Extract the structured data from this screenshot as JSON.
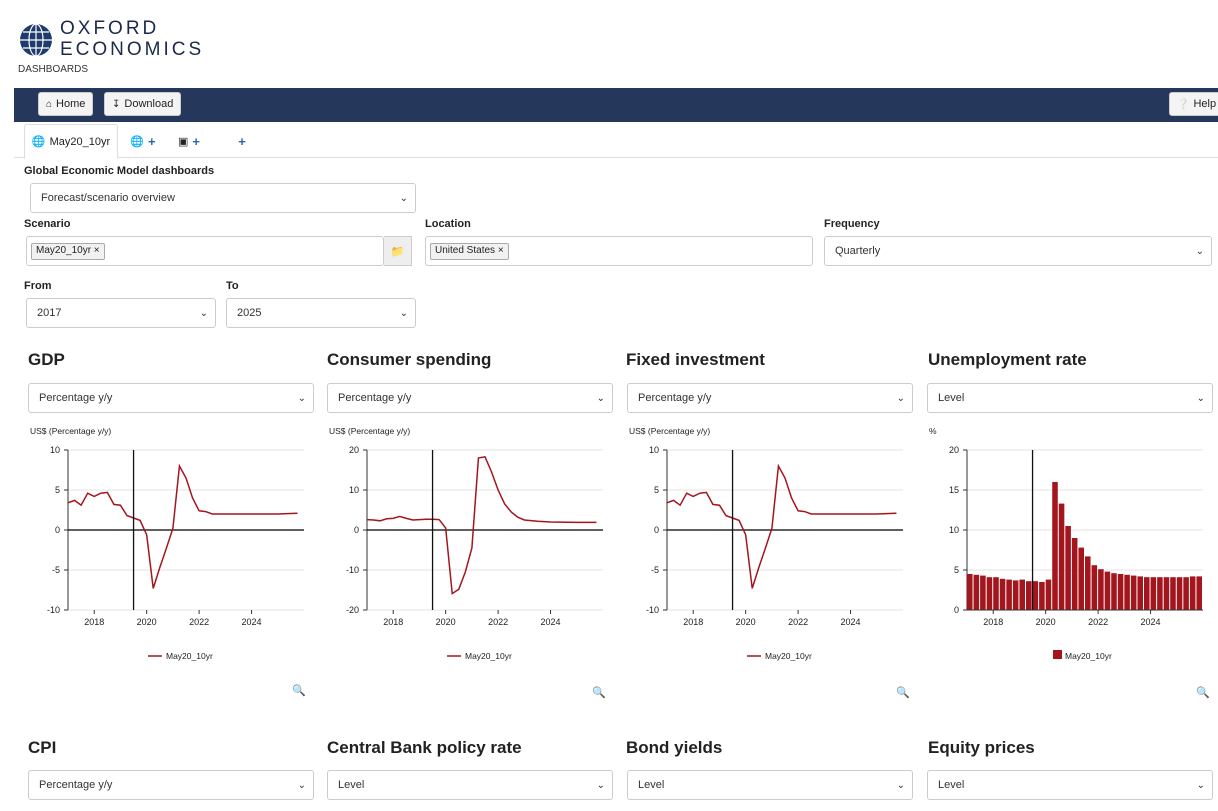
{
  "brand": {
    "line1": "OXFORD",
    "line2": "ECONOMICS",
    "sub": "DASHBOARDS"
  },
  "nav": {
    "home": "Home",
    "download": "Download",
    "help": "Help"
  },
  "tabs": {
    "active": "May20_10yr"
  },
  "model": {
    "label": "Global Economic Model dashboards",
    "value": "Forecast/scenario overview"
  },
  "scenario": {
    "label": "Scenario",
    "tag": "May20_10yr ×"
  },
  "location": {
    "label": "Location",
    "tag": "United States ×"
  },
  "frequency": {
    "label": "Frequency",
    "value": "Quarterly"
  },
  "from": {
    "label": "From",
    "value": "2017"
  },
  "to": {
    "label": "To",
    "value": "2025"
  },
  "panels": [
    {
      "title": "GDP",
      "select": "Percentage y/y"
    },
    {
      "title": "Consumer spending",
      "select": "Percentage y/y"
    },
    {
      "title": "Fixed investment",
      "select": "Percentage y/y"
    },
    {
      "title": "Unemployment rate",
      "select": "Level"
    },
    {
      "title": "CPI",
      "select": "Percentage y/y"
    },
    {
      "title": "Central Bank policy rate",
      "select": "Level"
    },
    {
      "title": "Bond yields",
      "select": "Level"
    },
    {
      "title": "Equity prices",
      "select": "Level"
    }
  ],
  "colors": {
    "navbar": "#25375a",
    "series": "#a3161e",
    "accent": "#2a67b1"
  },
  "chart_data": [
    {
      "type": "line",
      "ylabel": "US$ (Percentage y/y)",
      "ylim": [
        -10,
        10
      ],
      "yticks": [
        10,
        5,
        0,
        -5,
        -10
      ],
      "xlim": [
        2017,
        2026
      ],
      "xticks": [
        "2018",
        "2020",
        "2022",
        "2024"
      ],
      "legend": "bottom",
      "vline": 2019.5,
      "series": [
        {
          "name": "May20_10yr",
          "x": [
            2017,
            2017.25,
            2017.5,
            2017.75,
            2018,
            2018.25,
            2018.5,
            2018.75,
            2019,
            2019.25,
            2019.5,
            2019.75,
            2020,
            2020.25,
            2020.5,
            2020.75,
            2021,
            2021.25,
            2021.5,
            2021.75,
            2022,
            2022.25,
            2022.5,
            2022.75,
            2023,
            2024,
            2025,
            2025.75
          ],
          "values": [
            3.4,
            3.7,
            3.1,
            4.6,
            4.2,
            4.6,
            4.7,
            3.2,
            3.1,
            1.8,
            1.5,
            1.2,
            -0.6,
            -7.3,
            -4.7,
            -2.3,
            0.2,
            8.0,
            6.5,
            4.0,
            2.4,
            2.3,
            2.0,
            2.0,
            2.0,
            2.0,
            2.0,
            2.1
          ]
        }
      ]
    },
    {
      "type": "line",
      "ylabel": "US$ (Percentage y/y)",
      "ylim": [
        -20,
        20
      ],
      "yticks": [
        20,
        10,
        0,
        -10,
        -20
      ],
      "xlim": [
        2017,
        2026
      ],
      "xticks": [
        "2018",
        "2020",
        "2022",
        "2024"
      ],
      "legend": "bottom",
      "vline": 2019.5,
      "series": [
        {
          "name": "May20_10yr",
          "x": [
            2017,
            2017.25,
            2017.5,
            2017.75,
            2018,
            2018.25,
            2018.5,
            2018.75,
            2019,
            2019.25,
            2019.5,
            2019.75,
            2020,
            2020.25,
            2020.5,
            2020.75,
            2021,
            2021.25,
            2021.5,
            2021.75,
            2022,
            2022.25,
            2022.5,
            2022.75,
            2023,
            2023.5,
            2024,
            2025,
            2025.75
          ],
          "values": [
            2.6,
            2.5,
            2.3,
            2.8,
            2.9,
            3.4,
            2.9,
            2.5,
            2.6,
            2.7,
            2.7,
            2.6,
            0.5,
            -15.9,
            -14.8,
            -10.5,
            -4.5,
            18.0,
            18.3,
            14.5,
            10.0,
            6.5,
            4.5,
            3.2,
            2.5,
            2.2,
            2.0,
            1.9,
            1.9
          ]
        }
      ]
    },
    {
      "type": "line",
      "ylabel": "US$ (Percentage y/y)",
      "ylim": [
        -10,
        10
      ],
      "yticks": [
        10,
        5,
        0,
        -5,
        -10
      ],
      "xlim": [
        2017,
        2026
      ],
      "xticks": [
        "2018",
        "2020",
        "2022",
        "2024"
      ],
      "legend": "bottom",
      "vline": 2019.5,
      "series": [
        {
          "name": "May20_10yr",
          "x": [
            2017,
            2017.25,
            2017.5,
            2017.75,
            2018,
            2018.25,
            2018.5,
            2018.75,
            2019,
            2019.25,
            2019.5,
            2019.75,
            2020,
            2020.25,
            2020.5,
            2020.75,
            2021,
            2021.25,
            2021.5,
            2021.75,
            2022,
            2022.25,
            2022.5,
            2022.75,
            2023,
            2024,
            2025,
            2025.75
          ],
          "values": [
            3.4,
            3.7,
            3.1,
            4.6,
            4.2,
            4.6,
            4.7,
            3.2,
            3.1,
            1.8,
            1.5,
            1.2,
            -0.6,
            -7.3,
            -4.7,
            -2.3,
            0.2,
            8.0,
            6.5,
            4.0,
            2.4,
            2.3,
            2.0,
            2.0,
            2.0,
            2.0,
            2.0,
            2.1
          ]
        }
      ]
    },
    {
      "type": "bar",
      "ylabel": "%",
      "ylim": [
        0,
        20
      ],
      "yticks": [
        20,
        15,
        10,
        5,
        0
      ],
      "xlim": [
        2017,
        2026
      ],
      "xticks": [
        "2018",
        "2020",
        "2022",
        "2024"
      ],
      "legend": "bottom",
      "vline": 2019.5,
      "series": [
        {
          "name": "May20_10yr",
          "x": [
            2017,
            2017.25,
            2017.5,
            2017.75,
            2018,
            2018.25,
            2018.5,
            2018.75,
            2019,
            2019.25,
            2019.5,
            2019.75,
            2020,
            2020.25,
            2020.5,
            2020.75,
            2021,
            2021.25,
            2021.5,
            2021.75,
            2022,
            2022.25,
            2022.5,
            2022.75,
            2023,
            2023.25,
            2023.5,
            2023.75,
            2024,
            2024.25,
            2024.5,
            2024.75,
            2025,
            2025.25,
            2025.5,
            2025.75
          ],
          "values": [
            4.5,
            4.4,
            4.3,
            4.1,
            4.1,
            3.9,
            3.8,
            3.7,
            3.8,
            3.6,
            3.6,
            3.5,
            3.8,
            16.0,
            13.3,
            10.5,
            9.0,
            7.8,
            6.7,
            5.6,
            5.1,
            4.8,
            4.6,
            4.5,
            4.4,
            4.3,
            4.2,
            4.1,
            4.1,
            4.1,
            4.1,
            4.1,
            4.1,
            4.1,
            4.2,
            4.2
          ]
        }
      ]
    }
  ]
}
